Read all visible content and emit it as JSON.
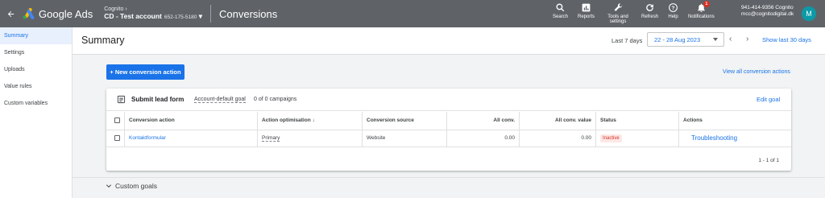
{
  "topbar": {
    "back_icon": "arrow-left-icon",
    "logo_text": "Google Ads",
    "account_parent": "Cognito",
    "account_name": "CD - Test account",
    "account_id": "652-175-5180",
    "page_title": "Conversions",
    "tools": [
      {
        "label": "Search",
        "icon": "search-icon"
      },
      {
        "label": "Reports",
        "icon": "reports-icon"
      },
      {
        "label": "Tools and settings",
        "icon": "wrench-icon"
      },
      {
        "label": "Refresh",
        "icon": "refresh-icon"
      },
      {
        "label": "Help",
        "icon": "help-icon"
      },
      {
        "label": "Notifications",
        "icon": "bell-icon",
        "badge": "1"
      }
    ],
    "user_line1": "941-414-9356 Cognito",
    "user_line2": "mcc@cognitodigital.dk",
    "avatar_letter": "M"
  },
  "sidebar": {
    "items": [
      {
        "label": "Summary",
        "active": true
      },
      {
        "label": "Settings",
        "active": false
      },
      {
        "label": "Uploads",
        "active": false
      },
      {
        "label": "Value rules",
        "active": false
      },
      {
        "label": "Custom variables",
        "active": false
      }
    ]
  },
  "header": {
    "title": "Summary",
    "range_label": "Last 7 days",
    "date_range": "22 - 28 Aug 2023",
    "show_last": "Show last 30 days"
  },
  "main": {
    "new_button": "+ New conversion action",
    "view_all": "View all conversion actions",
    "goal": {
      "name": "Submit lead form",
      "tag": "Account-default goal",
      "campaigns": "0 of 0 campaigns",
      "edit": "Edit goal"
    },
    "table": {
      "columns": [
        "Conversion action",
        "Action optimisation",
        "Conversion source",
        "All conv.",
        "All conv. value",
        "Status",
        "Actions"
      ],
      "rows": [
        {
          "action": "Kontaktformular",
          "optimisation": "Primary",
          "source": "Website",
          "all_conv": "0.00",
          "all_conv_value": "0.00",
          "status": "Inactive",
          "actions": "Troubleshooting"
        }
      ],
      "pager": "1 - 1 of 1"
    },
    "custom_goals": "Custom goals"
  },
  "colors": {
    "topbar": "#5f6368",
    "accent": "#1a73e8",
    "inactive": "#d93025"
  }
}
